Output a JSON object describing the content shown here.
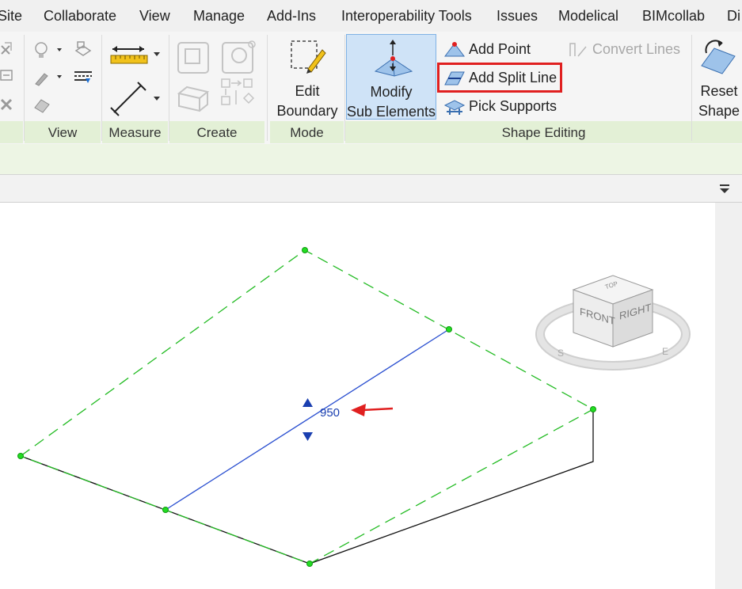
{
  "menu": {
    "items": [
      "Site",
      "Collaborate",
      "View",
      "Manage",
      "Add-Ins",
      "Interoperability Tools",
      "Issues",
      "Modelical",
      "BIMcollab",
      "Di"
    ]
  },
  "ribbon": {
    "panels": {
      "view": "View",
      "measure": "Measure",
      "create": "Create",
      "mode": "Mode",
      "shape_editing": "Shape Editing"
    },
    "mode": {
      "edit_boundary_line1": "Edit",
      "edit_boundary_line2": "Boundary"
    },
    "shape_editing": {
      "modify_line1": "Modify",
      "modify_line2": "Sub Elements",
      "add_point": "Add Point",
      "add_split_line": "Add Split Line",
      "pick_supports": "Pick Supports",
      "convert_lines": "Convert Lines",
      "reset_line1": "Reset",
      "reset_line2": "Shape"
    }
  },
  "viewport": {
    "elevation_value": "950",
    "viewcube": {
      "front": "FRONT",
      "right": "RIGHT",
      "top": "TOP"
    }
  },
  "colors": {
    "boundary_dash": "#22bb22",
    "vertex": "#22dd22",
    "split_line": "#2a4fd0",
    "annotation_arrow": "#e02020",
    "panel_title_bar": "#e3f0d6",
    "selected_button": "#cfe3f7"
  },
  "icons": [
    "unpin-icon",
    "unjoin-icon",
    "delete-icon",
    "lightbulb-icon",
    "hide-element-icon",
    "paint-brush-icon",
    "linework-icon",
    "eraser-icon",
    "aligned-dimension-icon",
    "measure-distance-icon",
    "create-assembly-icon",
    "create-similar-icon",
    "create-group-icon",
    "create-parts-icon",
    "edit-boundary-icon",
    "modify-sub-elements-icon",
    "add-point-icon",
    "add-split-line-icon",
    "pick-supports-icon",
    "convert-lines-icon",
    "reset-shape-icon",
    "view-dropdown-icon",
    "red-arrow-icon",
    "viewcube-icon"
  ]
}
